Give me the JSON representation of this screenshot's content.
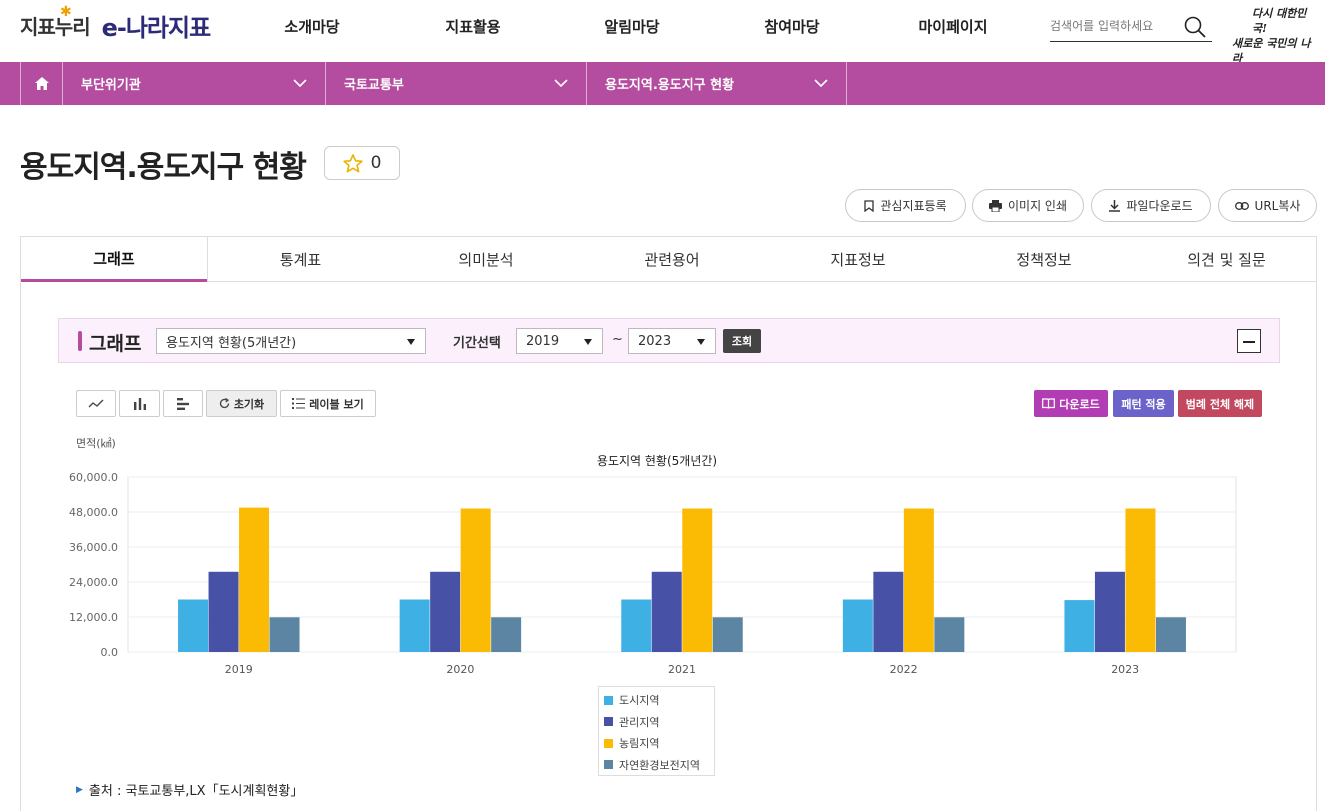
{
  "header": {
    "logo_main": "지표누리",
    "logo_sub": "e-나라지표",
    "nav": [
      "소개마당",
      "지표활용",
      "알림마당",
      "참여마당",
      "마이페이지"
    ],
    "search_placeholder": "검색어를 입력하세요",
    "slogan_line1": "다시 대한민국!",
    "slogan_line2": "새로운 국민의 나라"
  },
  "location": {
    "level1": "부단위기관",
    "level2": "국토교통부",
    "level3": "용도지역.용도지구 현황"
  },
  "page": {
    "title": "용도지역.용도지구 현황",
    "favorite_count": "0",
    "actions": [
      "관심지표등록",
      "이미지 인쇄",
      "파일다운로드",
      "URL복사"
    ]
  },
  "tabs": [
    {
      "label": "그래프",
      "active": true
    },
    {
      "label": "통계표",
      "active": false
    },
    {
      "label": "의미분석",
      "active": false
    },
    {
      "label": "관련용어",
      "active": false
    },
    {
      "label": "지표정보",
      "active": false
    },
    {
      "label": "정책정보",
      "active": false
    },
    {
      "label": "의견 및 질문",
      "active": false
    }
  ],
  "graph_panel": {
    "title": "그래프",
    "selected_chart": "용도지역 현황(5개년간)",
    "period_label": "기간선택",
    "start_year": "2019",
    "end_year": "2023",
    "range_sep": "~",
    "query_label": "조회",
    "tools": {
      "reset_label": "초기화",
      "label_view_label": "레이블 보기"
    },
    "buttons": {
      "download_label": "다운로드",
      "pattern_label": "패턴 적용",
      "legend_clear_label": "범례 전체 해제"
    },
    "colors": {
      "download": "#b23cb3",
      "pattern": "#6b63c9",
      "legend_clear": "#c2485f"
    }
  },
  "chart_data": {
    "type": "bar",
    "title": "용도지역 현황(5개년간)",
    "ylabel": "면적(㎢)",
    "xlabel": "",
    "categories": [
      "2019",
      "2020",
      "2021",
      "2022",
      "2023"
    ],
    "ylim": [
      0,
      60000
    ],
    "yticks": [
      "0.0",
      "12,000.0",
      "24,000.0",
      "36,000.0",
      "48,000.0",
      "60,000.0"
    ],
    "series": [
      {
        "name": "도시지역",
        "color": "#3eb0e4",
        "values": [
          18000,
          18000,
          18000,
          18000,
          17800
        ]
      },
      {
        "name": "관리지역",
        "color": "#4751a6",
        "values": [
          27500,
          27500,
          27500,
          27500,
          27500
        ]
      },
      {
        "name": "농림지역",
        "color": "#fbbb05",
        "values": [
          49500,
          49200,
          49200,
          49200,
          49200
        ]
      },
      {
        "name": "자연환경보전지역",
        "color": "#5b85a3",
        "values": [
          11900,
          11900,
          11900,
          11900,
          11900
        ]
      }
    ],
    "grid": true,
    "legend_position": "bottom"
  },
  "source": "출처 : 국토교통부,LX「도시계획현황」"
}
